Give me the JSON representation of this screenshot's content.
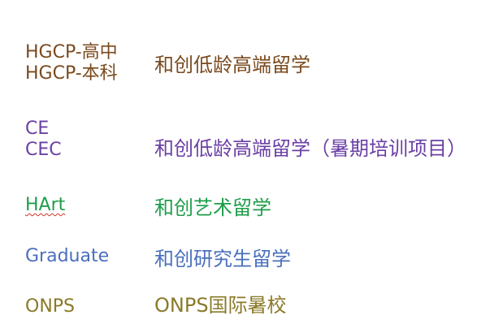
{
  "colors": {
    "brown": "#7a4a1e",
    "purple": "#6a3fa5",
    "green": "#1e9e4a",
    "blue": "#4a6fbd",
    "olive": "#8a7a28"
  },
  "rows": [
    {
      "codes": [
        "HGCP-高中",
        "HGCP-本科"
      ],
      "desc": "和创低龄高端留学"
    },
    {
      "codes": [
        "CE",
        "CEC"
      ],
      "desc": "和创低龄高端留学（暑期培训项目）"
    },
    {
      "codes": [
        "HArt"
      ],
      "desc": "和创艺术留学"
    },
    {
      "codes": [
        "Graduate"
      ],
      "desc": "和创研究生留学"
    },
    {
      "codes": [
        "ONPS"
      ],
      "desc": "ONPS国际暑校"
    }
  ]
}
